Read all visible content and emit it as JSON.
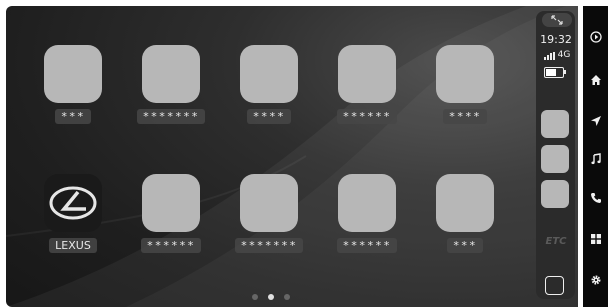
{
  "apps_row1": [
    {
      "label": "***"
    },
    {
      "label": "*******"
    },
    {
      "label": "****"
    },
    {
      "label": "******"
    },
    {
      "label": "****"
    }
  ],
  "apps_row2": [
    {
      "label": "LEXUS",
      "icon": "lexus-logo-icon"
    },
    {
      "label": "******"
    },
    {
      "label": "*******"
    },
    {
      "label": "******"
    },
    {
      "label": "***"
    }
  ],
  "page_indicator": {
    "count": 3,
    "active": 2
  },
  "status": {
    "time": "19:32",
    "network": "4G",
    "signal_bars": 3,
    "battery_level": 0.6
  },
  "dock": {
    "recent_app_count": 3,
    "etc_label": "ETC"
  },
  "sidebar": {
    "items": [
      {
        "icon": "play-circle-icon"
      },
      {
        "icon": "home-icon"
      },
      {
        "icon": "navigation-arrow-icon"
      },
      {
        "icon": "music-note-icon"
      },
      {
        "icon": "phone-icon"
      },
      {
        "icon": "apps-grid-icon"
      },
      {
        "icon": "gear-icon"
      }
    ]
  },
  "colors": {
    "tile": "#b7b7b7",
    "dock": "#2b2b2b",
    "sidebar": "#0a0a0a"
  }
}
